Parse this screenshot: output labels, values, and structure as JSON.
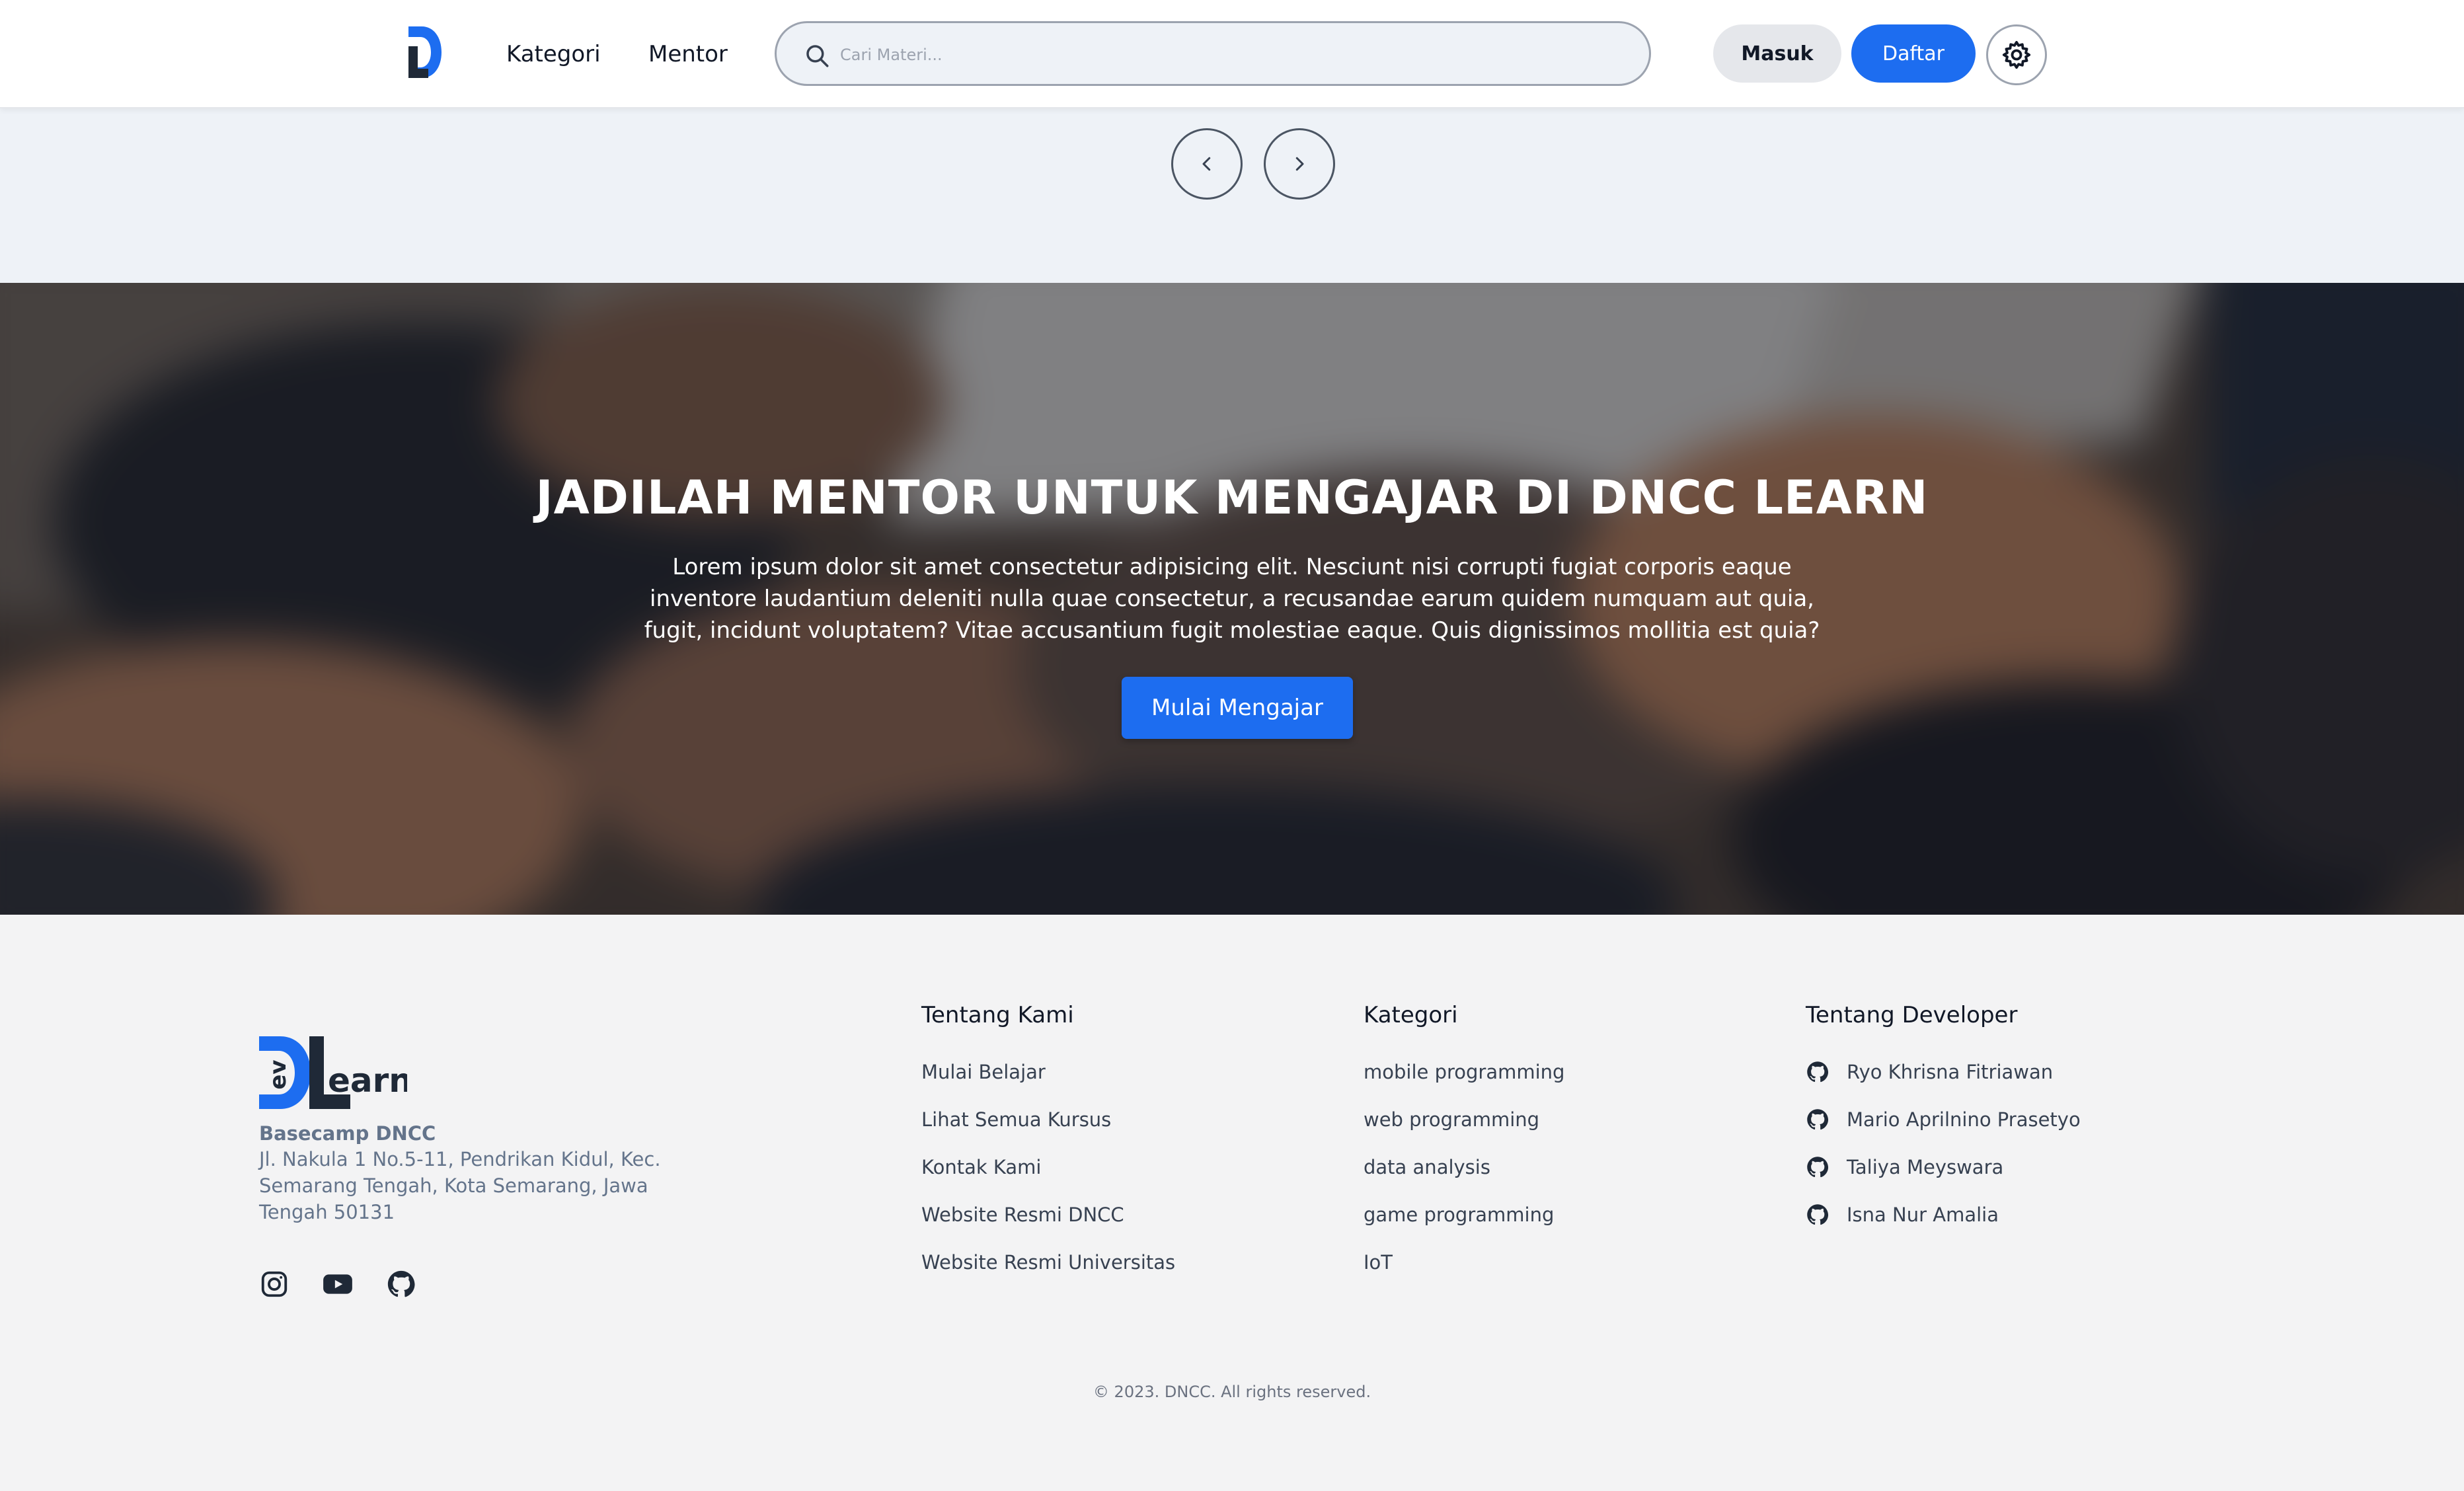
{
  "navbar": {
    "logo_icon": "dncc-logo-icon",
    "links": [
      "Kategori",
      "Mentor"
    ],
    "search": {
      "placeholder": "Cari Materi...",
      "icon": "search-icon"
    },
    "login_label": "Masuk",
    "register_label": "Daftar",
    "theme_icon": "gear-icon"
  },
  "carousel": {
    "prev_icon": "chevron-left-icon",
    "next_icon": "chevron-right-icon"
  },
  "hero": {
    "title": "JADILAH MENTOR UNTUK MENGAJAR DI DNCC LEARN",
    "text": "Lorem ipsum dolor sit amet consectetur adipisicing elit. Nesciunt nisi corrupti fugiat corporis eaque inventore laudantium deleniti nulla quae consectetur, a recusandae earum quidem numquam aut quia, fugit, incidunt voluptatem? Vitae accusantium fugit molestiae eaque. Quis dignissimos mollitia est quia?",
    "cta_label": "Mulai Mengajar"
  },
  "footer": {
    "logo_text": "earn",
    "logo_sub": "ev",
    "org": "Basecamp DNCC",
    "address": "Jl. Nakula 1 No.5-11, Pendrikan Kidul, Kec. Semarang Tengah, Kota Semarang, Jawa Tengah 50131",
    "socials": [
      "instagram-icon",
      "youtube-icon",
      "github-icon"
    ],
    "columns": [
      {
        "title": "Tentang Kami",
        "links": [
          "Mulai Belajar",
          "Lihat Semua Kursus",
          "Kontak Kami",
          "Website Resmi DNCC",
          "Website Resmi Universitas"
        ]
      },
      {
        "title": "Kategori",
        "links": [
          "mobile programming",
          "web programming",
          "data analysis",
          "game programming",
          "IoT"
        ]
      },
      {
        "title": "Tentang Developer",
        "links": [
          "Ryo Khrisna Fitriawan",
          "Mario Aprilnino Prasetyo",
          "Taliya Meyswara",
          "Isna Nur Amalia"
        ]
      }
    ],
    "copyright": "© 2023. DNCC. All rights reserved."
  },
  "colors": {
    "primary": "#1d6df0",
    "footer_bg": "#f3f3f4",
    "muted_text": "#64748b"
  }
}
